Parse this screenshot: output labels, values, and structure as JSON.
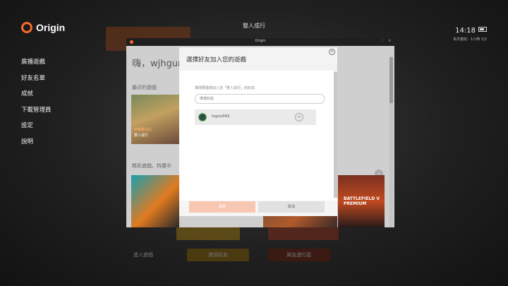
{
  "app": {
    "logo_text": "Origin",
    "top_title": "雙人成行",
    "clock_time": "14:18",
    "clock_sub": "本次遊玩：1小時 1分",
    "battery_label": "電池"
  },
  "side_nav": {
    "items": [
      {
        "label": "廣播遊戲"
      },
      {
        "label": "好友名單"
      },
      {
        "label": "成就"
      },
      {
        "label": "下載管理員"
      },
      {
        "label": "設定"
      },
      {
        "label": "說明"
      }
    ]
  },
  "bottom_bar": {
    "buttons": [
      {
        "label": "進入遊戲"
      },
      {
        "label": "邀請好友"
      },
      {
        "label": "將友遊行區"
      }
    ]
  },
  "window": {
    "title": "Origin",
    "greeting": "嗨，wjhgur",
    "recent_section": "最近的遊戲",
    "recent_tile_badge": "熱騰騰資訊",
    "recent_tile_name": "雙人成行",
    "featured_section": "精彩遊戲，特惠中",
    "premium_tile_label": "BATTLEFIELD V PREMIUM",
    "next_arrow": "›"
  },
  "dialog": {
    "title": "選擇好友加入您的遊戲",
    "prompt": "選擇要邀請加入您「雙人成行」的好友：",
    "search_placeholder": "搜尋好友",
    "friends": [
      {
        "name": "logoo992"
      }
    ],
    "invite_label": "邀請",
    "cancel_label": "取消"
  },
  "colors": {
    "accent": "#f56c2d",
    "invite_disabled": "#f8c7b1",
    "online_ring": "#6ac05a"
  },
  "icons": {
    "close": "close-icon",
    "add_friend": "plus-circle-icon",
    "logo": "origin-logo-icon"
  }
}
